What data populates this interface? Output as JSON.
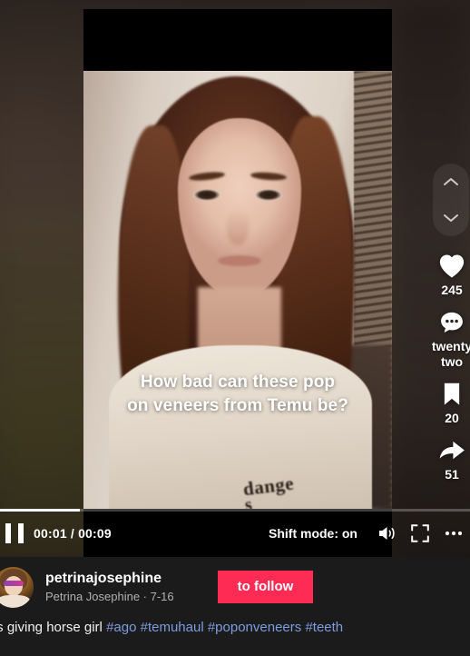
{
  "video": {
    "caption_line1": "How bad can these pop",
    "caption_line2": "on veneers from Temu be?",
    "shirt_text": "dange",
    "shirt_text2": "s"
  },
  "rail": {
    "scroll_up_icon": "chevron-up-icon",
    "scroll_down_icon": "chevron-down-icon",
    "like": {
      "icon": "heart-icon",
      "count": "245"
    },
    "comment": {
      "icon": "comment-icon",
      "count": "twenty\ntwo"
    },
    "bookmark": {
      "icon": "bookmark-icon",
      "count": "20"
    },
    "share": {
      "icon": "share-arrow-icon",
      "count": "51"
    }
  },
  "controls": {
    "play_state_icon": "pause-icon",
    "current_time": "00:01",
    "total_time": "00:09",
    "time_display": "00:01 / 00:09",
    "shift_mode_label": "Shift mode: on",
    "volume_icon": "speaker-on-icon",
    "fullscreen_icon": "fullscreen-icon",
    "more_icon": "ellipsis-icon",
    "progress_percent": 17
  },
  "info": {
    "avatar_name": "avatar",
    "handle": "petrinajosephine",
    "display_name": "Petrina Josephine",
    "separator": "·",
    "date": "7-16",
    "subline": "Petrina Josephine · 7-16",
    "follow_label": "to follow",
    "follow_color": "#fe2c55",
    "description_text": "ts giving horse girl ",
    "hashtags": [
      "#ago",
      "#temuhaul",
      "#poponveneers",
      "#teeth"
    ],
    "hashtag_color": "#7c9ce0"
  }
}
